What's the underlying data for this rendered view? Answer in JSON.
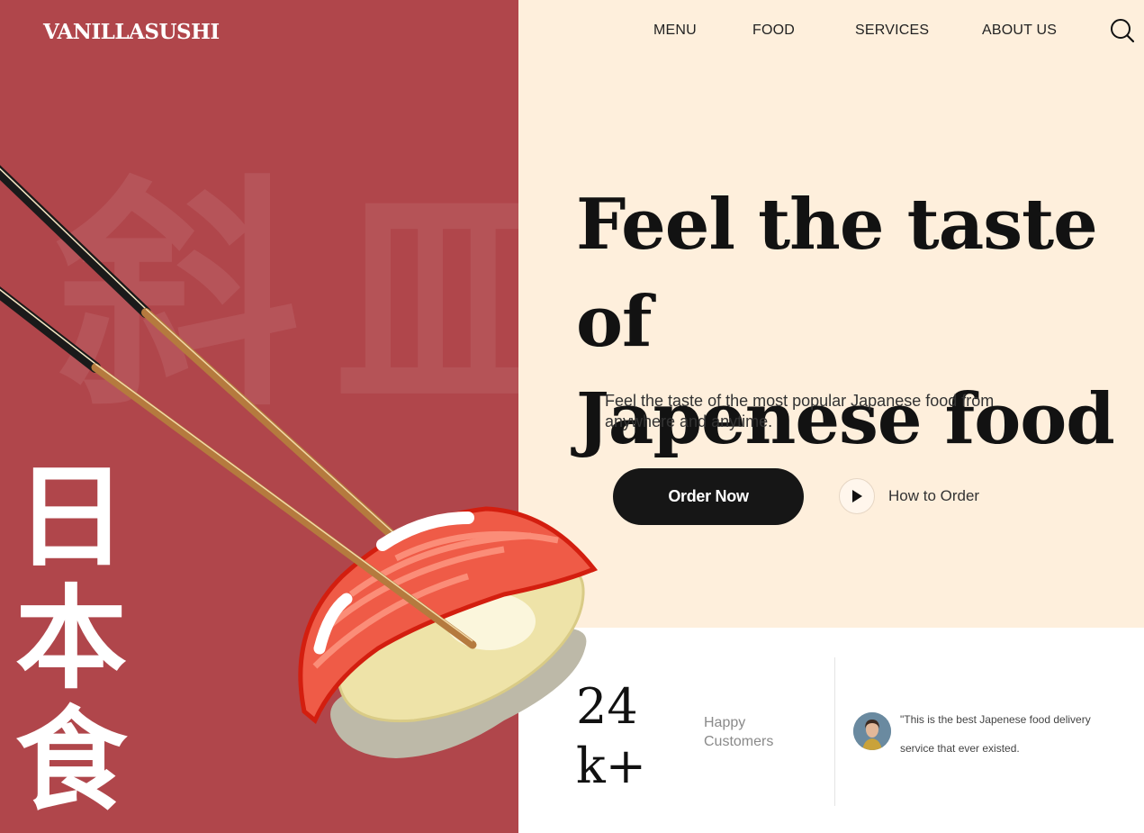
{
  "brand": {
    "logo": "VANILLASUSHI"
  },
  "nav": {
    "items": [
      {
        "label": "MENU"
      },
      {
        "label": "FOOD"
      },
      {
        "label": "SERVICES"
      },
      {
        "label": "ABOUT US"
      }
    ],
    "search_icon": "search-icon"
  },
  "decor": {
    "background_kanji": [
      "斜",
      "皿"
    ],
    "vertical_kanji": [
      "日",
      "本",
      "食"
    ]
  },
  "hero": {
    "title_line1": "Feel the taste of",
    "title_line2": "Japenese food",
    "subtitle": "Feel the taste of the most popular Japanese food from anywhere and anytime.",
    "order_button": "Order Now",
    "how_to_label": "How to Order",
    "play_icon": "play-icon"
  },
  "stats": {
    "number_line1": "24",
    "number_line2": "k+",
    "label_line1": "Happy",
    "label_line2": "Customers"
  },
  "testimonial": {
    "quote": "\"This is the best Japenese food delivery service that ever existed."
  },
  "colors": {
    "brand_red": "#b0464b",
    "cream": "#feefdc",
    "dark": "#161616",
    "white": "#ffffff"
  }
}
